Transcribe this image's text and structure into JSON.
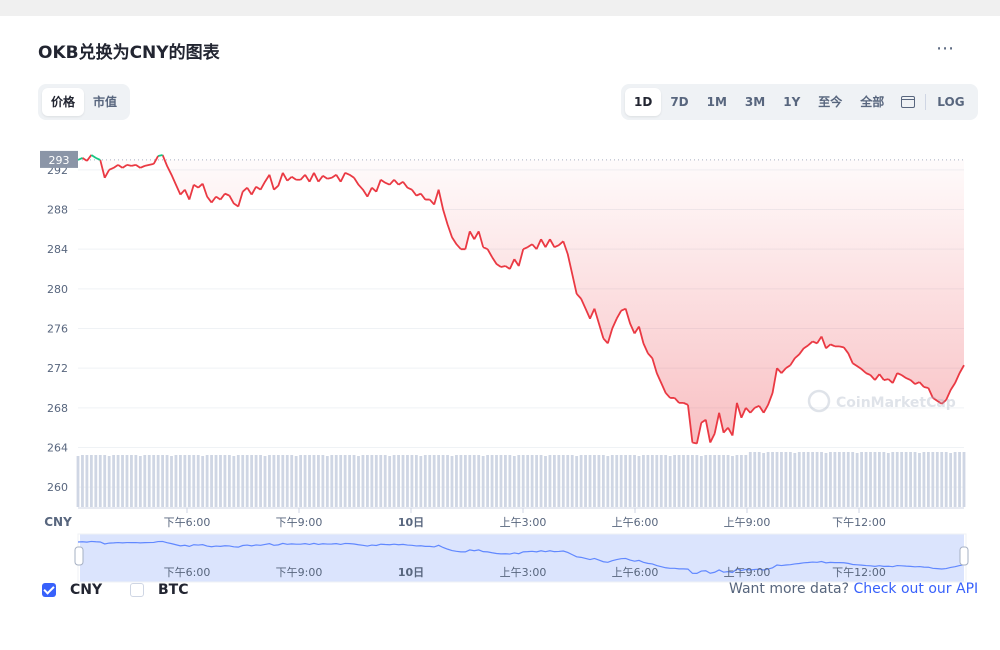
{
  "header": {
    "title": "OKB兑换为CNY的图表",
    "more_icon": "⋯"
  },
  "metric_tabs": [
    {
      "label": "价格",
      "active": true
    },
    {
      "label": "市值",
      "active": false
    }
  ],
  "range_tabs": [
    {
      "label": "1D",
      "active": true
    },
    {
      "label": "7D",
      "active": false
    },
    {
      "label": "1M",
      "active": false
    },
    {
      "label": "3M",
      "active": false
    },
    {
      "label": "1Y",
      "active": false
    },
    {
      "label": "至今",
      "active": false
    },
    {
      "label": "全部",
      "active": false
    }
  ],
  "log_label": "LOG",
  "watermark": "CoinMarketCap",
  "legend": [
    {
      "label": "CNY",
      "checked": true
    },
    {
      "label": "BTC",
      "checked": false
    }
  ],
  "footer": {
    "text": "Want more data? ",
    "link": "Check out our API"
  },
  "colors": {
    "up": "#16c784",
    "down": "#ea3943",
    "accent": "#3861fb",
    "volume": "#cfd6e4",
    "nav_fill": "#dbe4fd"
  },
  "chart_data": {
    "type": "line",
    "y_unit": "CNY",
    "ylim": [
      258,
      294
    ],
    "y_ticks": [
      292,
      288,
      284,
      280,
      276,
      272,
      268,
      264,
      260
    ],
    "current_price": 293,
    "baseline": 293,
    "x_ticks": [
      "下午6:00",
      "下午9:00",
      "10日",
      "上午3:00",
      "上午6:00",
      "上午9:00",
      "下午12:00"
    ],
    "series": [
      {
        "values": [
          293.0,
          293.2,
          292.9,
          293.5,
          293.2,
          293.0,
          291.2,
          292.0,
          292.2,
          292.5,
          292.2,
          292.5,
          292.4,
          292.5,
          292.2,
          292.4,
          292.5,
          292.6,
          293.4,
          293.5,
          292.4,
          291.5,
          290.5,
          289.5,
          290.0,
          289.0,
          290.5,
          290.2,
          290.6,
          289.3,
          288.7,
          289.3,
          289.0,
          289.6,
          289.4,
          288.6,
          288.3,
          289.8,
          290.2,
          289.5,
          290.3,
          290.0,
          290.8,
          291.5,
          290.0,
          290.4,
          291.7,
          290.9,
          291.3,
          291.0,
          291.0,
          291.5,
          290.8,
          291.7,
          290.8,
          291.4,
          291.1,
          291.2,
          291.5,
          290.8,
          291.7,
          291.5,
          291.2,
          290.5,
          290.0,
          289.3,
          290.2,
          289.8,
          291.0,
          290.7,
          290.5,
          291.0,
          290.5,
          290.8,
          290.2,
          290.0,
          289.4,
          289.6,
          289.0,
          289.0,
          288.5,
          290.0,
          288.0,
          286.5,
          285.2,
          284.5,
          284.0,
          284.0,
          285.8,
          285.0,
          285.8,
          284.2,
          284.0,
          283.2,
          282.5,
          282.2,
          282.3,
          282.0,
          283.0,
          282.3,
          284.0,
          284.2,
          284.5,
          284.0,
          285.0,
          284.2,
          285.0,
          284.2,
          284.4,
          284.8,
          283.5,
          281.5,
          279.5,
          279.0,
          278.0,
          277.0,
          278.0,
          276.5,
          275.0,
          274.5,
          276.0,
          277.0,
          277.8,
          278.0,
          276.5,
          275.5,
          276.2,
          274.5,
          273.5,
          273.0,
          271.5,
          270.5,
          269.5,
          269.0,
          269.0,
          268.5,
          268.5,
          268.3,
          264.5,
          264.4,
          266.5,
          266.8,
          264.5,
          265.4,
          267.5,
          265.5,
          266.0,
          265.2,
          268.5,
          267.0,
          268.0,
          267.5,
          268.0,
          268.2,
          267.5,
          268.3,
          269.5,
          272.0,
          271.5,
          272.0,
          272.3,
          273.0,
          273.4,
          274.0,
          274.3,
          274.7,
          274.5,
          275.2,
          274.0,
          274.4,
          274.2,
          274.2,
          274.1,
          273.5,
          272.5,
          272.2,
          271.9,
          271.5,
          271.3,
          270.8,
          271.4,
          270.8,
          270.9,
          270.5,
          271.5,
          271.3,
          271.0,
          270.8,
          270.4,
          270.6,
          270.1,
          270.0,
          269.0,
          268.7,
          268.4,
          268.8,
          269.8,
          270.5,
          271.5,
          272.3
        ]
      }
    ],
    "nav_x_ticks": [
      "下午6:00",
      "下午9:00",
      "10日",
      "上午3:00",
      "上午6:00",
      "上午9:00",
      "下午12:00"
    ]
  }
}
